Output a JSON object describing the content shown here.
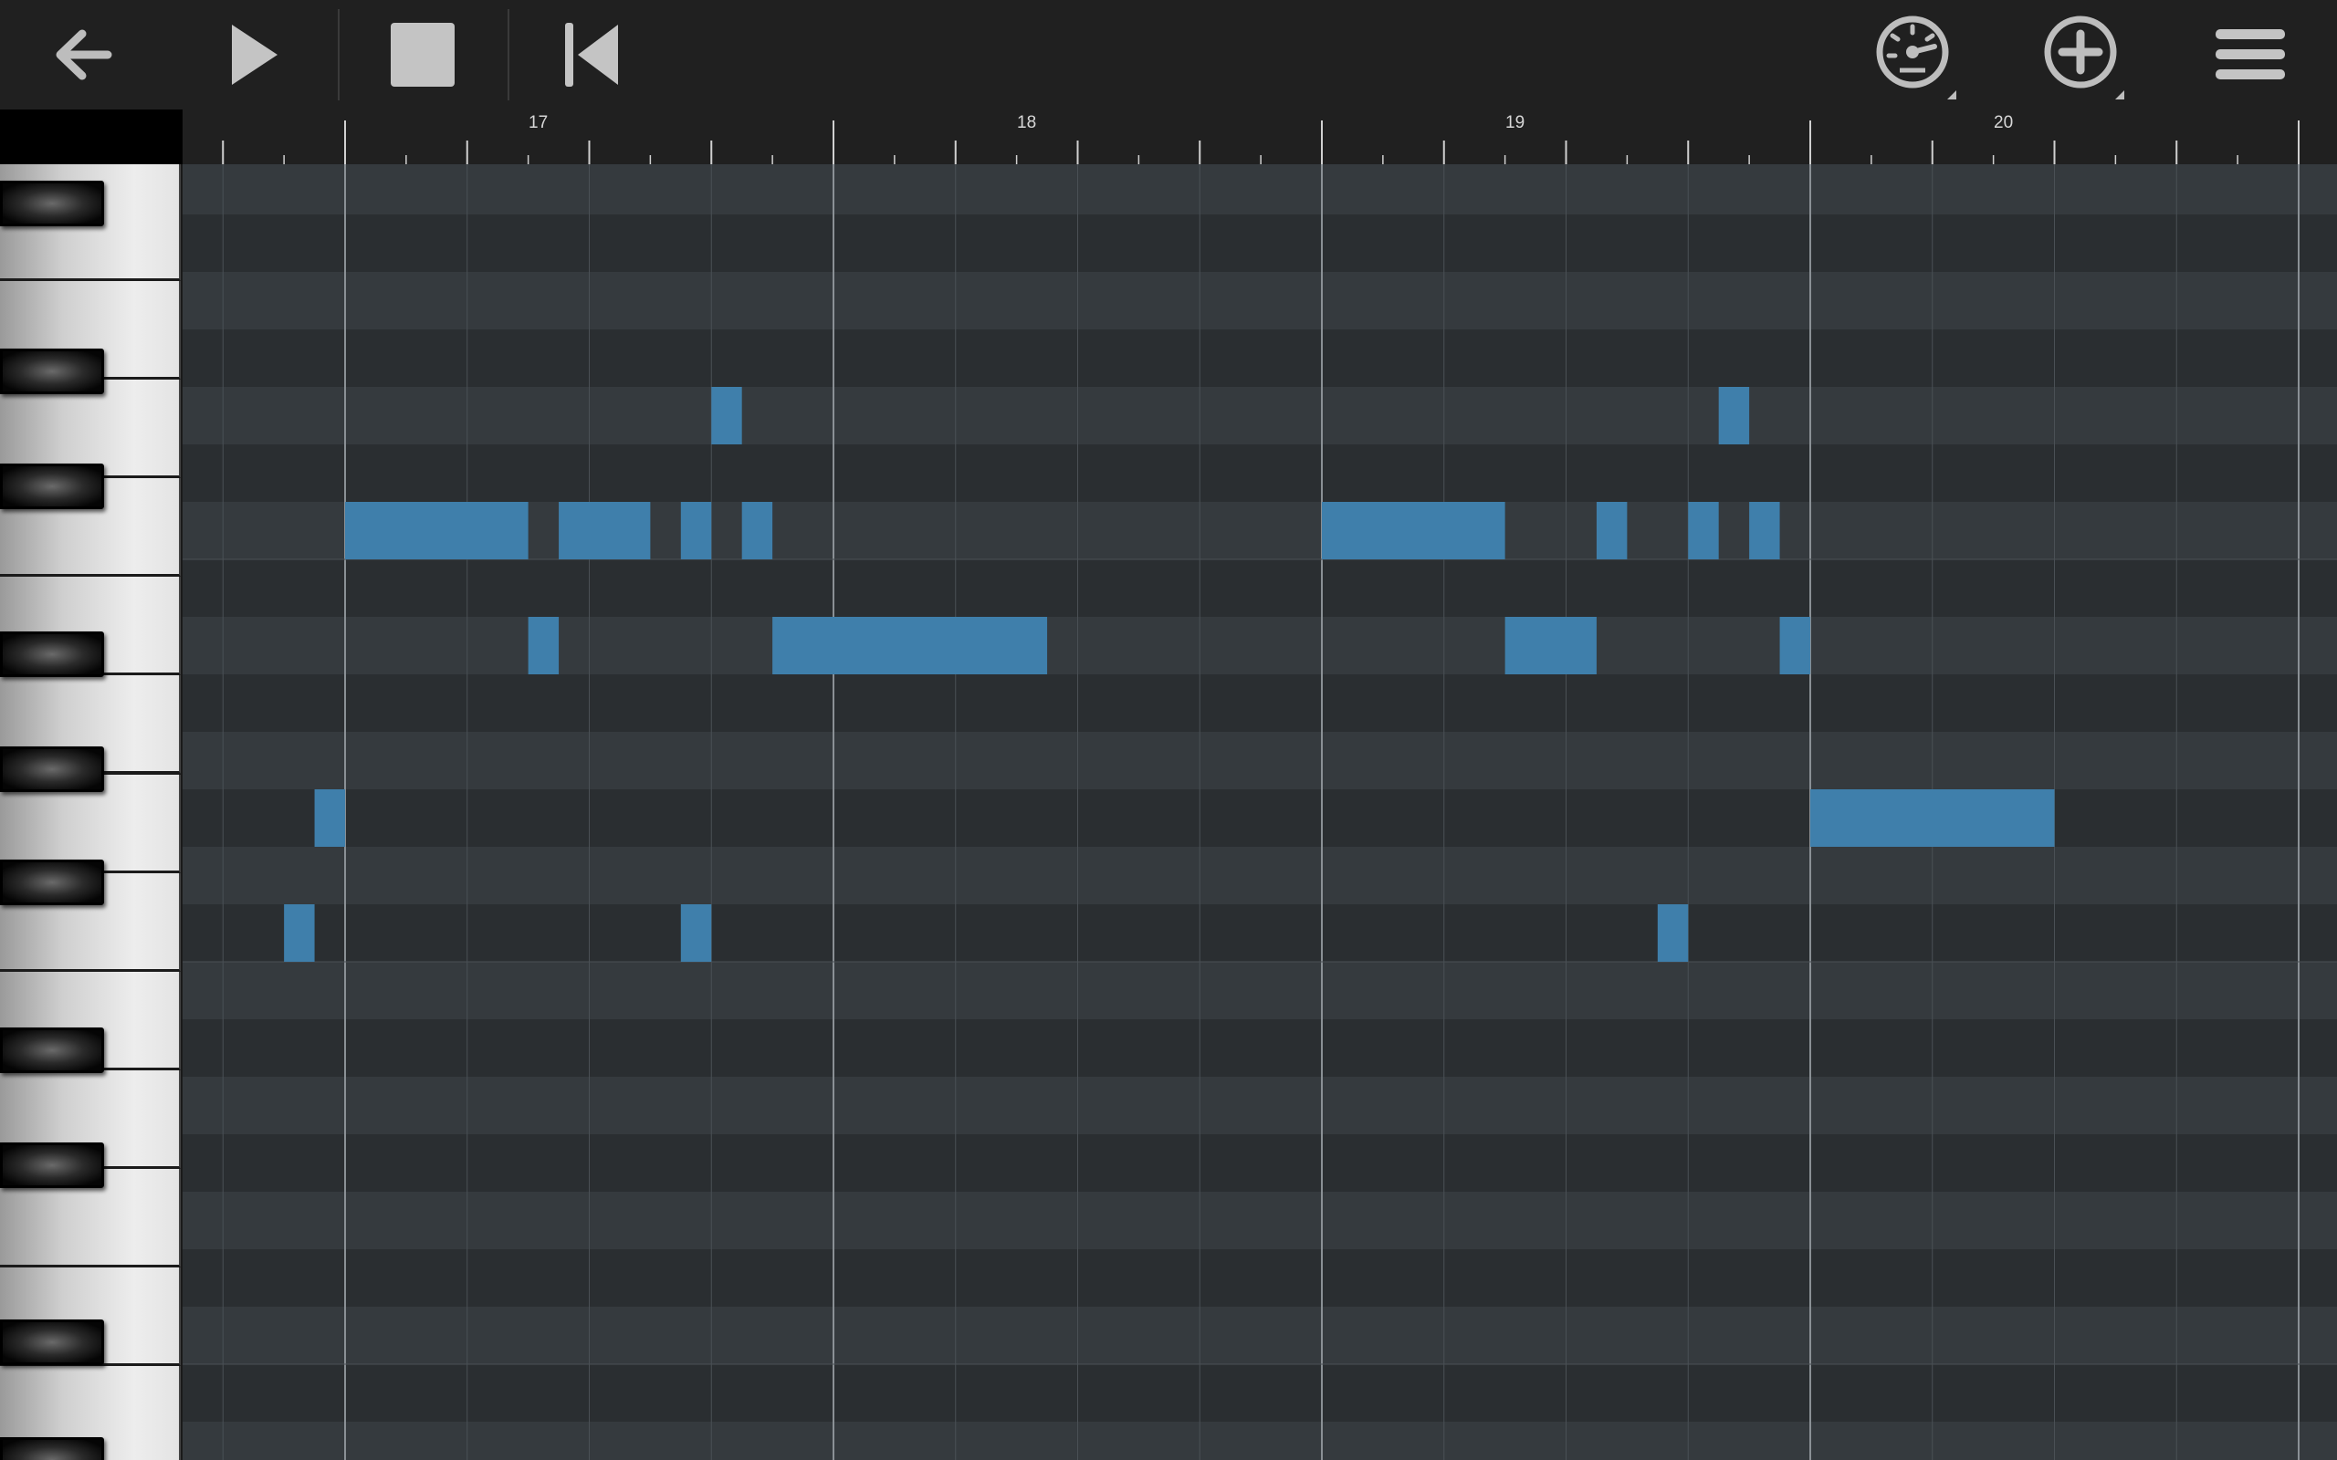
{
  "toolbar": {
    "buttons": [
      {
        "name": "back-button",
        "icon": "arrow-left-icon"
      },
      {
        "name": "play-button",
        "icon": "play-icon"
      },
      {
        "name": "stop-button",
        "icon": "stop-icon"
      },
      {
        "name": "rewind-button",
        "icon": "skip-to-start-icon"
      },
      {
        "name": "tempo-button",
        "icon": "metronome-gauge-icon"
      },
      {
        "name": "add-button",
        "icon": "plus-circle-icon"
      },
      {
        "name": "menu-button",
        "icon": "hamburger-menu-icon"
      }
    ]
  },
  "ruler": {
    "bar_labels": [
      "17",
      "18",
      "19",
      "20"
    ]
  },
  "colors": {
    "toolbar_bg": "#202020",
    "note": "#3f7fab",
    "row_light": "#353a3e",
    "row_dark": "#2a2e31",
    "grid_line": "#4a5055",
    "bar_line": "#8a9095"
  },
  "piano_roll": {
    "start_bar": 16.5,
    "beats_per_bar": 4,
    "visible_rows": 23,
    "notes": [
      {
        "row": 4,
        "start": 17.75,
        "length": 0.0625
      },
      {
        "row": 4,
        "start": 19.8125,
        "length": 0.0625
      },
      {
        "row": 6,
        "start": 17.0,
        "length": 0.375
      },
      {
        "row": 6,
        "start": 17.4375,
        "length": 0.1875
      },
      {
        "row": 6,
        "start": 17.6875,
        "length": 0.0625
      },
      {
        "row": 6,
        "start": 17.8125,
        "length": 0.0625
      },
      {
        "row": 6,
        "start": 19.0,
        "length": 0.375
      },
      {
        "row": 6,
        "start": 19.5625,
        "length": 0.0625
      },
      {
        "row": 6,
        "start": 19.75,
        "length": 0.0625
      },
      {
        "row": 6,
        "start": 19.875,
        "length": 0.0625
      },
      {
        "row": 8,
        "start": 17.375,
        "length": 0.0625
      },
      {
        "row": 8,
        "start": 17.875,
        "length": 0.5625
      },
      {
        "row": 8,
        "start": 19.375,
        "length": 0.1875
      },
      {
        "row": 8,
        "start": 19.9375,
        "length": 0.0625
      },
      {
        "row": 11,
        "start": 16.9375,
        "length": 0.0625
      },
      {
        "row": 11,
        "start": 20.0,
        "length": 0.5
      },
      {
        "row": 13,
        "start": 16.875,
        "length": 0.0625
      },
      {
        "row": 13,
        "start": 17.6875,
        "length": 0.0625
      },
      {
        "row": 13,
        "start": 19.6875,
        "length": 0.0625
      }
    ]
  }
}
